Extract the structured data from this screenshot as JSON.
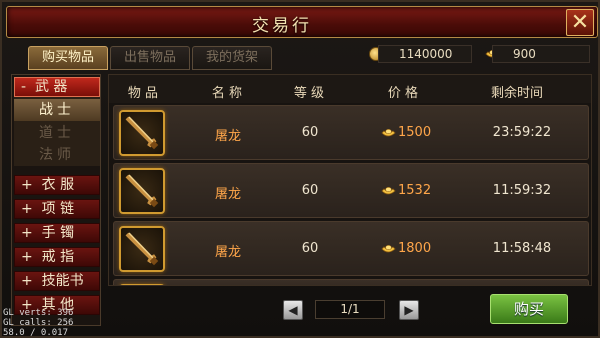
{
  "window": {
    "title": "交易行",
    "close_glyph": "✕"
  },
  "tabs": [
    {
      "label": "购买物品",
      "active": true
    },
    {
      "label": "出售物品",
      "active": false
    },
    {
      "label": "我的货架",
      "active": false
    }
  ],
  "currency": {
    "coins": "1140000",
    "ingots": "900"
  },
  "sidebar": {
    "categories": [
      {
        "prefix": "-",
        "label": "武 器",
        "open": true
      },
      {
        "prefix": "+",
        "label": "衣 服"
      },
      {
        "prefix": "+",
        "label": "项 链"
      },
      {
        "prefix": "+",
        "label": "手 镯"
      },
      {
        "prefix": "+",
        "label": "戒 指"
      },
      {
        "prefix": "+",
        "label": "技能书"
      },
      {
        "prefix": "+",
        "label": "其 他"
      }
    ],
    "subcategories": [
      {
        "label": "战士",
        "selected": true
      },
      {
        "label": "道士",
        "selected": false
      },
      {
        "label": "法师",
        "selected": false
      }
    ]
  },
  "table": {
    "headers": [
      "物 品",
      "名 称",
      "等 级",
      "价 格",
      "剩余时间"
    ],
    "rows": [
      {
        "icon": "sword-icon",
        "name": "屠龙",
        "level": "60",
        "price": "1500",
        "time": "23:59:22"
      },
      {
        "icon": "sword-icon",
        "name": "屠龙",
        "level": "60",
        "price": "1532",
        "time": "11:59:32"
      },
      {
        "icon": "sword-icon",
        "name": "屠龙",
        "level": "60",
        "price": "1800",
        "time": "11:58:48"
      }
    ]
  },
  "pager": {
    "page": "1/1",
    "prev": "◀",
    "next": "▶"
  },
  "buy_label": "购买",
  "debug": {
    "line1": "GL verts:   396",
    "line2": "GL calls:   256",
    "line3": "58.0 / 0.017"
  }
}
